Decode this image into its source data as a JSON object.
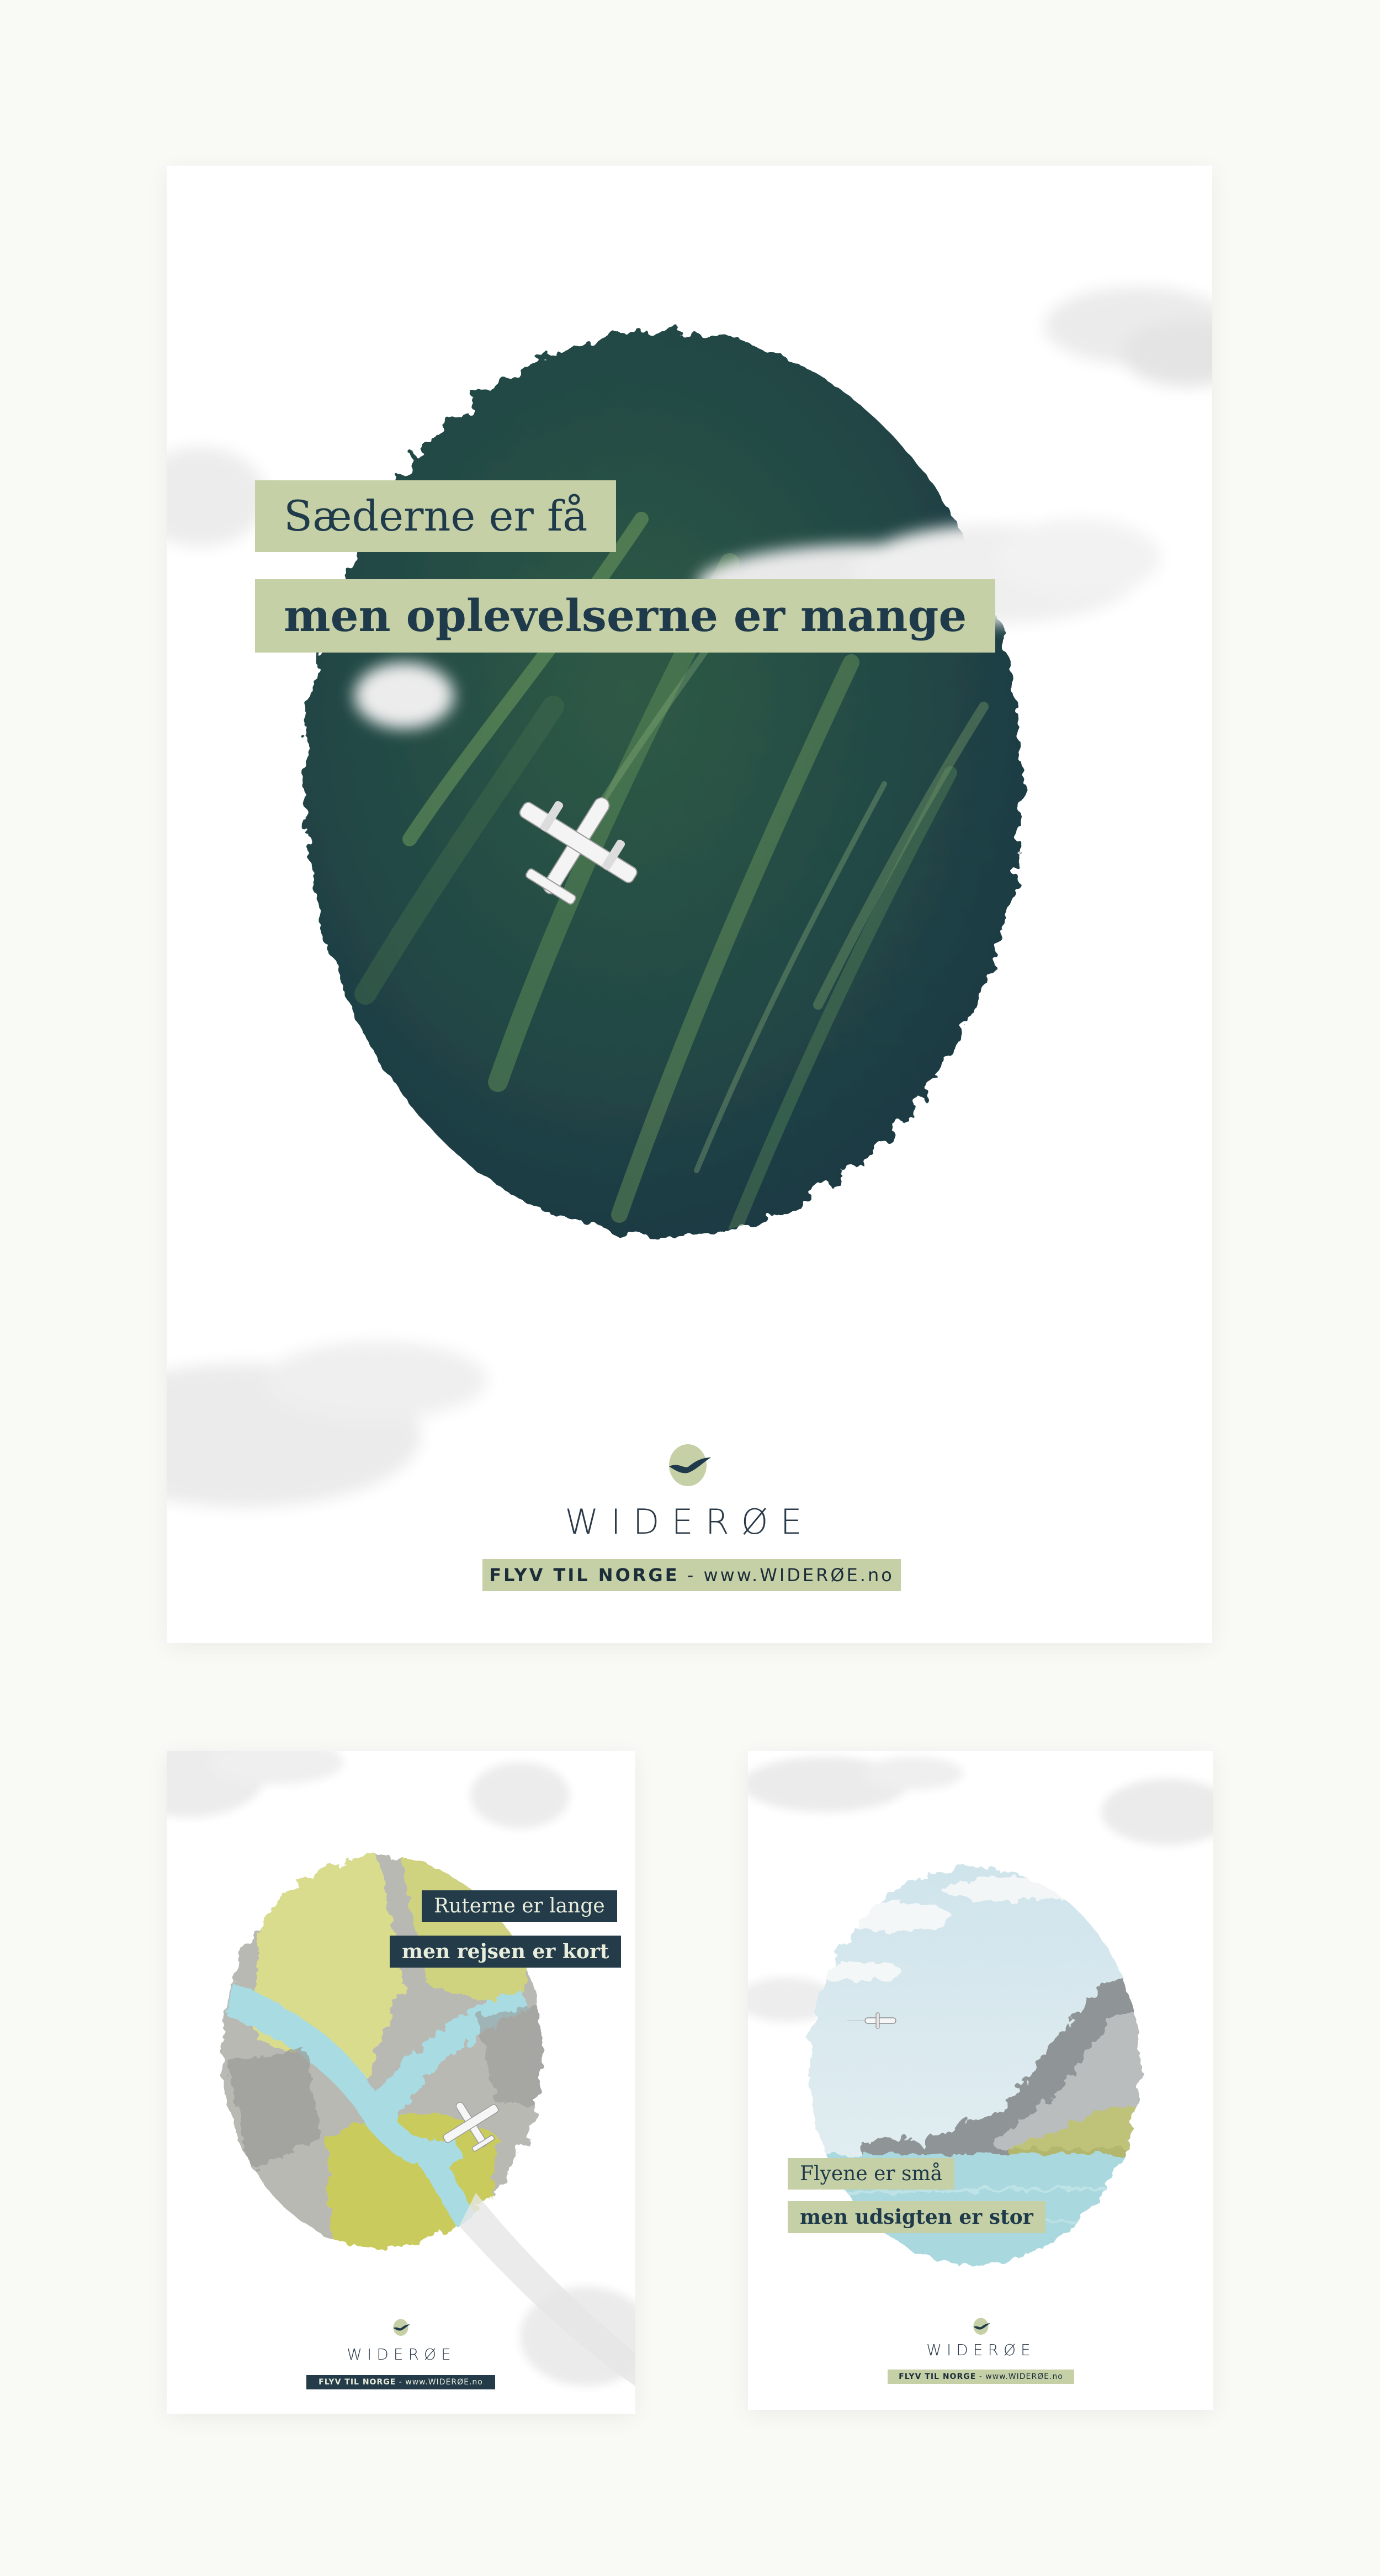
{
  "colors": {
    "page_background": "#f9f9f6",
    "sage_label": "#c6d0a6",
    "navy_label": "#243b4a",
    "forest_dark": "#1d3a3f",
    "river_blue": "#a8dbe2",
    "fjord_sky": "#d6e8ef"
  },
  "posters": {
    "main": {
      "headline_light": "Sæderne er få",
      "headline_bold": "men oplevelserne er mange",
      "brand_icon": "wideroe-bird-icon",
      "brand_name": "WIDERØE",
      "cta_strong": "FLYV TIL NORGE",
      "cta_url": "- www.WIDERØE.no",
      "illustration": "airplane-over-forest-illustration"
    },
    "river": {
      "headline_light": "Ruterne er lange",
      "headline_bold": "men rejsen er kort",
      "brand_icon": "wideroe-bird-icon",
      "brand_name": "WIDERØE",
      "cta_strong": "FLYV TIL NORGE",
      "cta_url": "- www.WIDERØE.no",
      "illustration": "airplane-over-river-illustration"
    },
    "fjord": {
      "headline_light": "Flyene er små",
      "headline_bold": "men udsigten er stor",
      "brand_icon": "wideroe-bird-icon",
      "brand_name": "WIDERØE",
      "cta_strong": "FLYV TIL NORGE",
      "cta_url": "- www.WIDERØE.no",
      "illustration": "airplane-over-fjord-illustration"
    }
  }
}
